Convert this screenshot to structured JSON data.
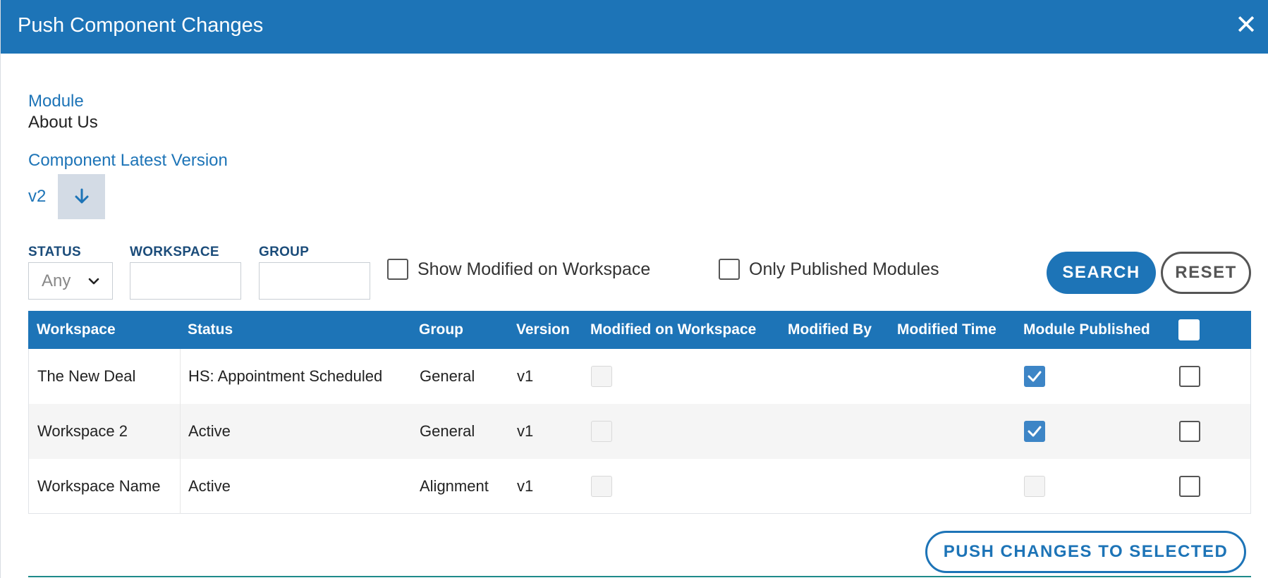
{
  "dialog": {
    "title": "Push Component Changes"
  },
  "module": {
    "label": "Module",
    "value": "About Us"
  },
  "component_version": {
    "label": "Component Latest Version",
    "value": "v2"
  },
  "filters": {
    "status_label": "STATUS",
    "status_value": "Any",
    "workspace_label": "WORKSPACE",
    "workspace_value": "",
    "group_label": "GROUP",
    "group_value": "",
    "show_modified_label": "Show Modified on Workspace",
    "show_modified_checked": false,
    "only_published_label": "Only Published Modules",
    "only_published_checked": false,
    "search_label": "SEARCH",
    "reset_label": "RESET"
  },
  "table": {
    "headers": {
      "workspace": "Workspace",
      "status": "Status",
      "group": "Group",
      "version": "Version",
      "modified_on_workspace": "Modified on Workspace",
      "modified_by": "Modified By",
      "modified_time": "Modified Time",
      "module_published": "Module Published"
    },
    "rows": [
      {
        "workspace": "The New Deal",
        "status": "HS: Appointment Scheduled",
        "group": "General",
        "version": "v1",
        "modified_by": "",
        "modified_time": "",
        "module_published": true,
        "selected": false
      },
      {
        "workspace": "Workspace 2",
        "status": "Active",
        "group": "General",
        "version": "v1",
        "modified_by": "",
        "modified_time": "",
        "module_published": true,
        "selected": false
      },
      {
        "workspace": "Workspace Name",
        "status": "Active",
        "group": "Alignment",
        "version": "v1",
        "modified_by": "",
        "modified_time": "",
        "module_published": false,
        "selected": false
      }
    ]
  },
  "actions": {
    "push_label": "PUSH CHANGES TO SELECTED"
  },
  "colors": {
    "primary": "#1d74b7",
    "checked": "#3d85c6"
  }
}
